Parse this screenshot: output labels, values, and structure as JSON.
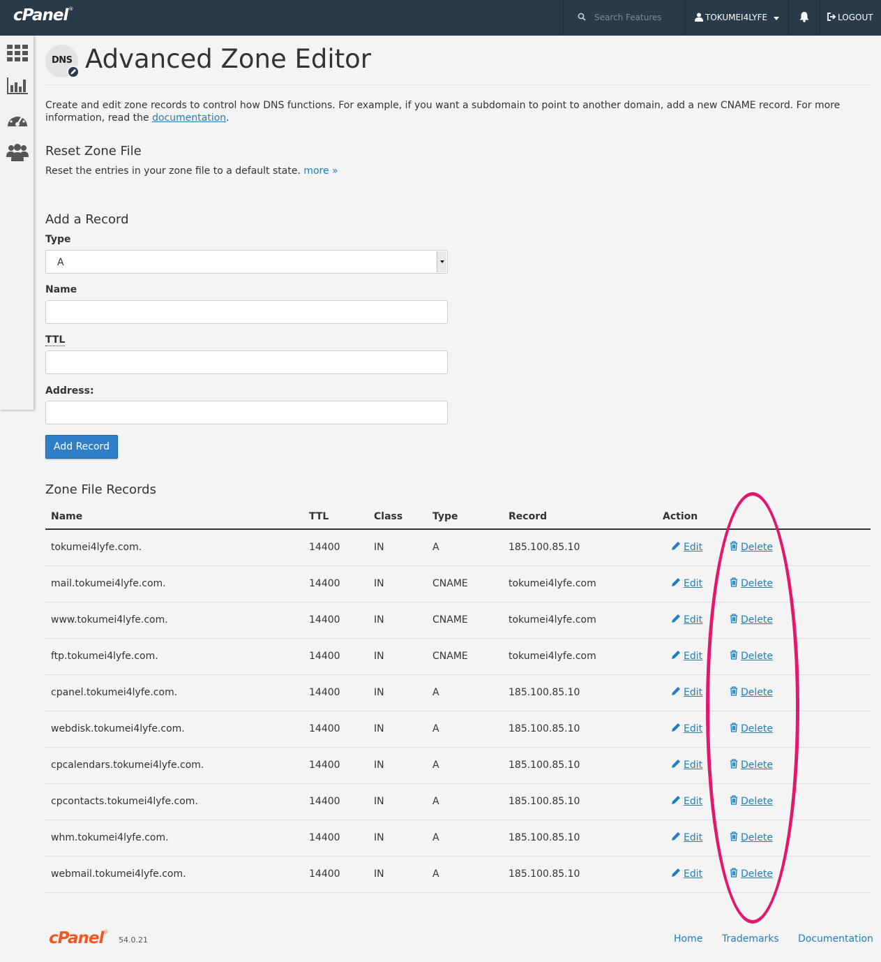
{
  "topbar": {
    "logo": "cPanel",
    "search_placeholder": "Search Features",
    "username": "TOKUMEI4LYFE",
    "logout": "LOGOUT"
  },
  "page": {
    "badge": "DNS",
    "title": "Advanced Zone Editor",
    "intro_text": "Create and edit zone records to control how DNS functions. For example, if you want a subdomain to point to another domain, add a new CNAME record. For more information, read the",
    "intro_link": "documentation",
    "intro_end": "."
  },
  "reset": {
    "heading": "Reset Zone File",
    "text": "Reset the entries in your zone file to a default state.",
    "more": "more »"
  },
  "add_record": {
    "heading": "Add a Record",
    "type_label": "Type",
    "type_value": "A",
    "name_label": "Name",
    "name_value": "",
    "ttl_label": "TTL",
    "ttl_value": "",
    "address_label": "Address:",
    "address_value": "",
    "button": "Add Record"
  },
  "records": {
    "heading": "Zone File Records",
    "columns": [
      "Name",
      "TTL",
      "Class",
      "Type",
      "Record",
      "Action"
    ],
    "edit_label": "Edit",
    "delete_label": "Delete",
    "rows": [
      {
        "name": "tokumei4lyfe.com.",
        "ttl": "14400",
        "class": "IN",
        "type": "A",
        "record": "185.100.85.10"
      },
      {
        "name": "mail.tokumei4lyfe.com.",
        "ttl": "14400",
        "class": "IN",
        "type": "CNAME",
        "record": "tokumei4lyfe.com"
      },
      {
        "name": "www.tokumei4lyfe.com.",
        "ttl": "14400",
        "class": "IN",
        "type": "CNAME",
        "record": "tokumei4lyfe.com"
      },
      {
        "name": "ftp.tokumei4lyfe.com.",
        "ttl": "14400",
        "class": "IN",
        "type": "CNAME",
        "record": "tokumei4lyfe.com"
      },
      {
        "name": "cpanel.tokumei4lyfe.com.",
        "ttl": "14400",
        "class": "IN",
        "type": "A",
        "record": "185.100.85.10"
      },
      {
        "name": "webdisk.tokumei4lyfe.com.",
        "ttl": "14400",
        "class": "IN",
        "type": "A",
        "record": "185.100.85.10"
      },
      {
        "name": "cpcalendars.tokumei4lyfe.com.",
        "ttl": "14400",
        "class": "IN",
        "type": "A",
        "record": "185.100.85.10"
      },
      {
        "name": "cpcontacts.tokumei4lyfe.com.",
        "ttl": "14400",
        "class": "IN",
        "type": "A",
        "record": "185.100.85.10"
      },
      {
        "name": "whm.tokumei4lyfe.com.",
        "ttl": "14400",
        "class": "IN",
        "type": "A",
        "record": "185.100.85.10"
      },
      {
        "name": "webmail.tokumei4lyfe.com.",
        "ttl": "14400",
        "class": "IN",
        "type": "A",
        "record": "185.100.85.10"
      }
    ]
  },
  "footer": {
    "logo": "cPanel",
    "version": "54.0.21",
    "links": [
      "Home",
      "Trademarks",
      "Documentation"
    ]
  },
  "colors": {
    "topbar": "#293a4a",
    "link": "#1c80c5",
    "primary_button": "#2f7fc8",
    "annotation_oval": "#e3176c",
    "footer_logo": "#f05a22"
  },
  "icons": {
    "sidebar": [
      "apps-grid-icon",
      "bar-chart-icon",
      "dashboard-gauge-icon",
      "users-group-icon"
    ],
    "topbar": [
      "search-icon",
      "user-icon",
      "bell-icon",
      "logout-icon"
    ],
    "actions": [
      "pencil-icon",
      "trash-icon"
    ]
  }
}
